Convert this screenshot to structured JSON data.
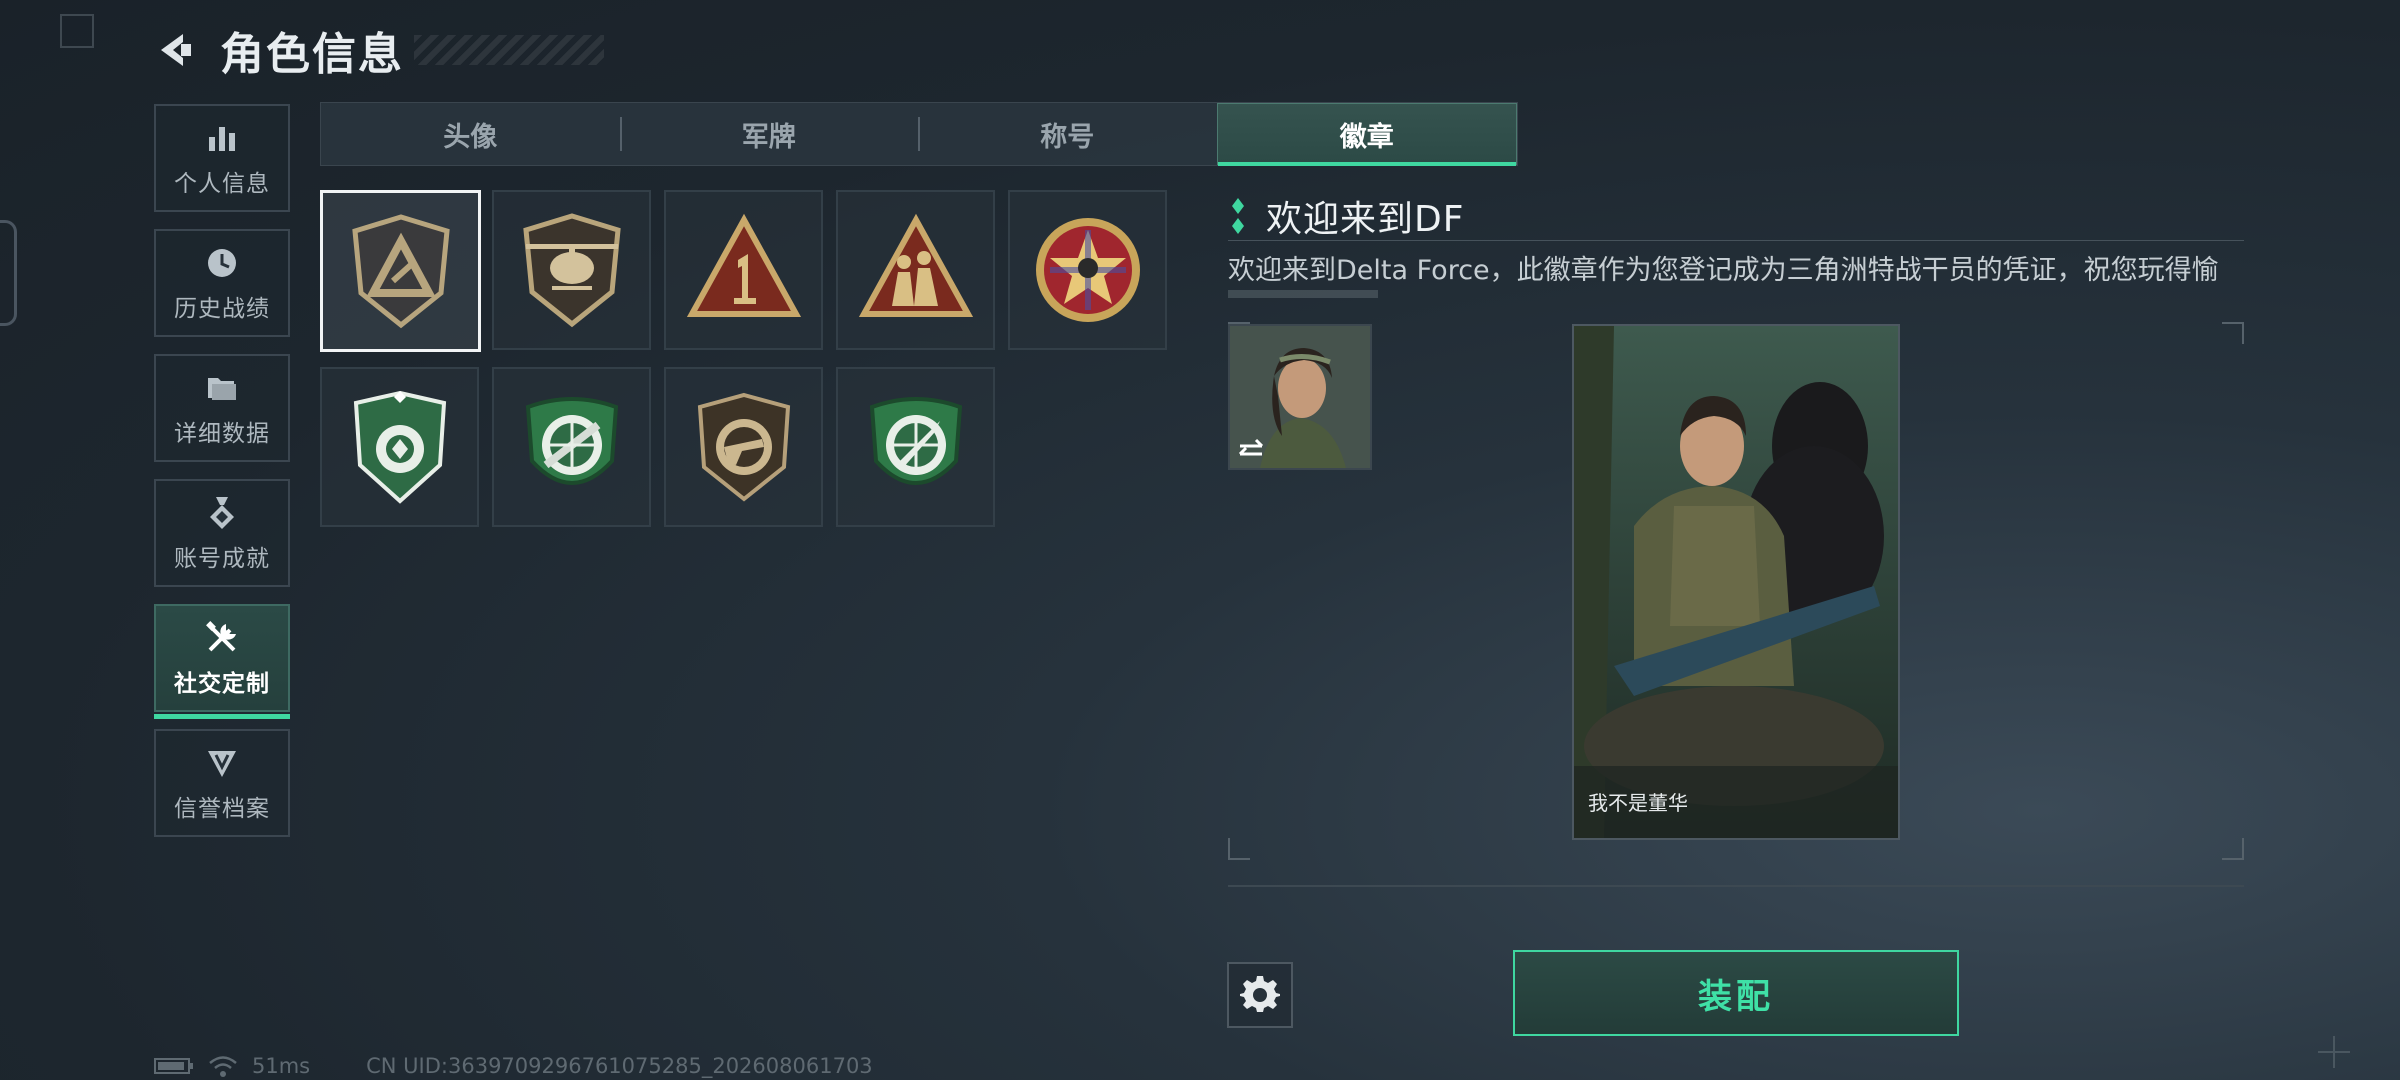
{
  "header": {
    "title": "角色信息"
  },
  "sidebar": {
    "items": [
      {
        "label": "个人信息",
        "icon": "bar-chart-icon"
      },
      {
        "label": "历史战绩",
        "icon": "history-clock-icon"
      },
      {
        "label": "详细数据",
        "icon": "folder-icon"
      },
      {
        "label": "账号成就",
        "icon": "achievement-icon"
      },
      {
        "label": "社交定制",
        "icon": "tools-icon",
        "active": true
      },
      {
        "label": "信誉档案",
        "icon": "reputation-icon"
      }
    ]
  },
  "tabs": [
    {
      "label": "头像"
    },
    {
      "label": "军牌"
    },
    {
      "label": "称号"
    },
    {
      "label": "徽章",
      "active": true
    }
  ],
  "badges": [
    {
      "icon": "delta-shield-badge-icon",
      "selected": true
    },
    {
      "icon": "helicopter-badge-icon"
    },
    {
      "icon": "number-one-triangle-badge-icon"
    },
    {
      "icon": "soldiers-triangle-badge-icon"
    },
    {
      "icon": "star-round-badge-icon"
    },
    {
      "icon": "green-shield-badge-icon"
    },
    {
      "icon": "rifle-crosshair-green-badge-icon"
    },
    {
      "icon": "pistol-crosshair-brown-badge-icon"
    },
    {
      "icon": "knife-crosshair-green-badge-icon"
    }
  ],
  "detail": {
    "title": "欢迎来到DF",
    "description": "欢迎来到Delta Force，此徽章作为您登记成为三角洲特战干员的凭证，祝您玩得愉",
    "card_caption": "我不是董华"
  },
  "actions": {
    "equip_label": "装配"
  },
  "status": {
    "ping": "51ms",
    "uid": "CN UID:3639709296761075285_202608061703"
  },
  "colors": {
    "accent": "#3fd7a0",
    "background": "#1d262e"
  }
}
